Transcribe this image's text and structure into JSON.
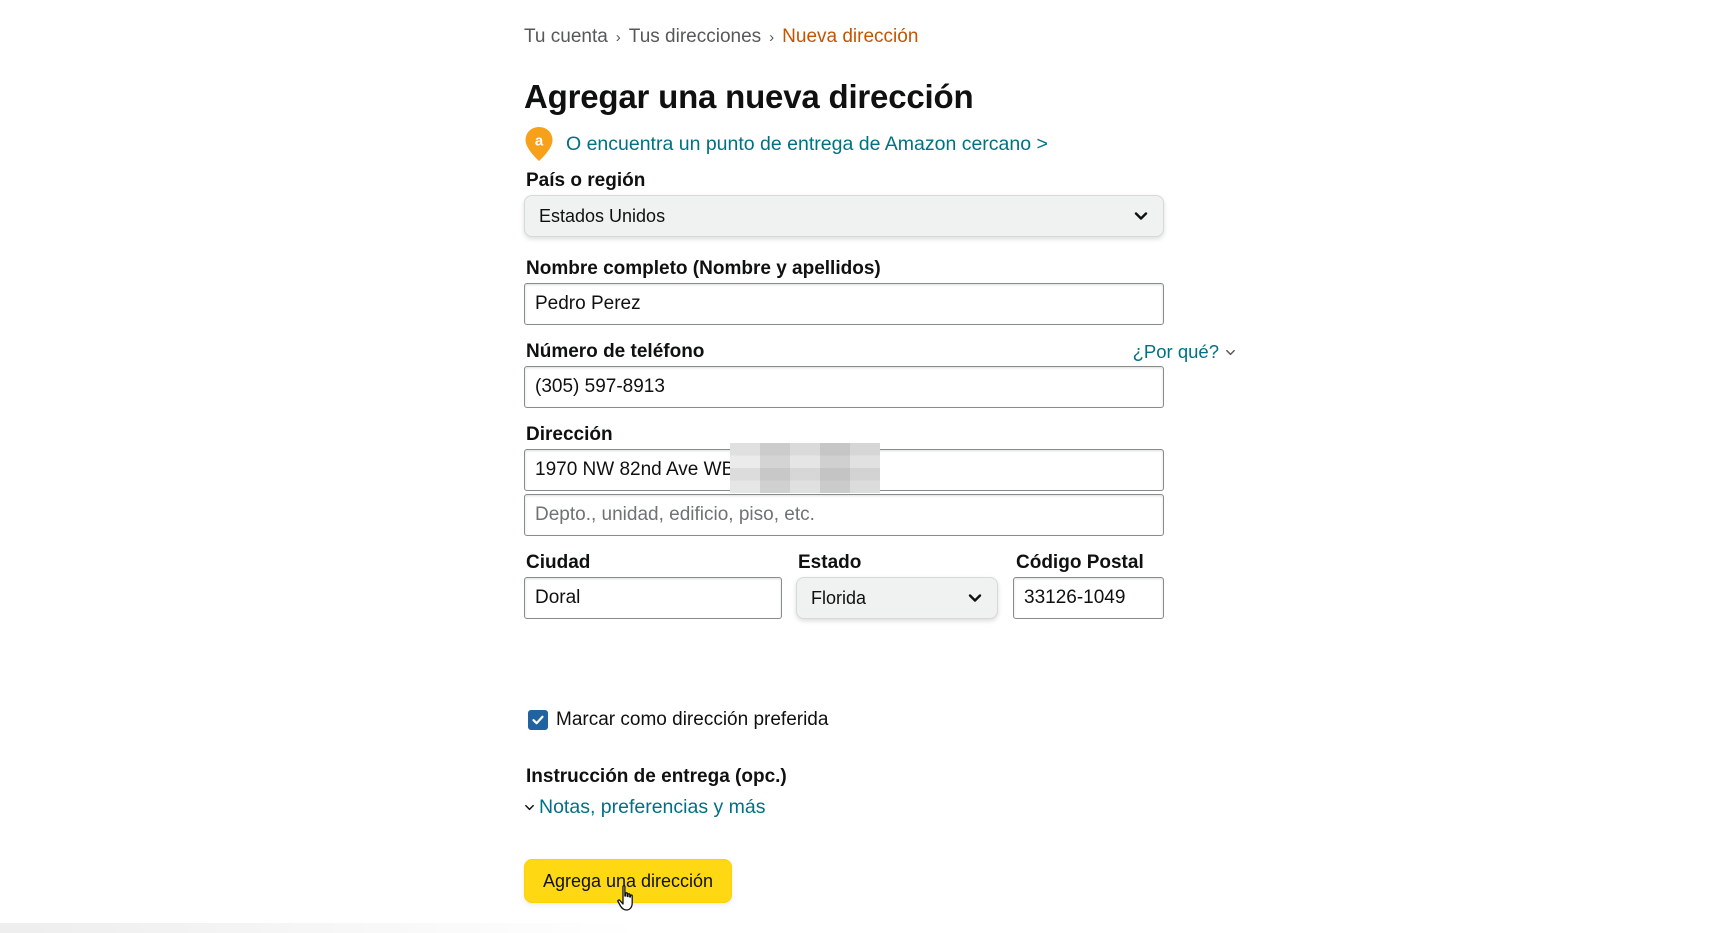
{
  "breadcrumb": {
    "items": [
      "Tu cuenta",
      "Tus direcciones"
    ],
    "separator": "›",
    "current": "Nueva dirección"
  },
  "page_title": "Agregar una nueva dirección",
  "pickup_link": "O encuentra un punto de entrega de Amazon cercano >",
  "pickup_icon_letter": "a",
  "country": {
    "label": "País o región",
    "value": "Estados Unidos"
  },
  "full_name": {
    "label": "Nombre completo (Nombre y apellidos)",
    "value": "Pedro Perez"
  },
  "phone": {
    "label": "Número de teléfono",
    "value": "(305) 597-8913",
    "why_link": "¿Por qué?"
  },
  "address": {
    "label": "Dirección",
    "line1_value": "1970 NW 82nd Ave WBF",
    "line2_placeholder": "Depto., unidad, edificio, piso, etc."
  },
  "city": {
    "label": "Ciudad",
    "value": "Doral"
  },
  "state": {
    "label": "Estado",
    "value": "Florida"
  },
  "zip": {
    "label": "Código Postal",
    "value": "33126-1049"
  },
  "preferred": {
    "label": "Marcar como dirección preferida",
    "checked": true
  },
  "delivery": {
    "label": "Instrucción de entrega (opc.)",
    "link": "Notas, preferencias y más"
  },
  "submit_button": "Agrega una dirección",
  "colors": {
    "link": "#007185",
    "breadcrumb_current": "#c45500",
    "primary_button": "#ffd814",
    "checkbox": "#2162a1",
    "pin": "#f7a11b"
  },
  "icons": [
    "map-pin-icon",
    "chevron-down-icon",
    "checkmark-icon",
    "hand-cursor-icon"
  ]
}
